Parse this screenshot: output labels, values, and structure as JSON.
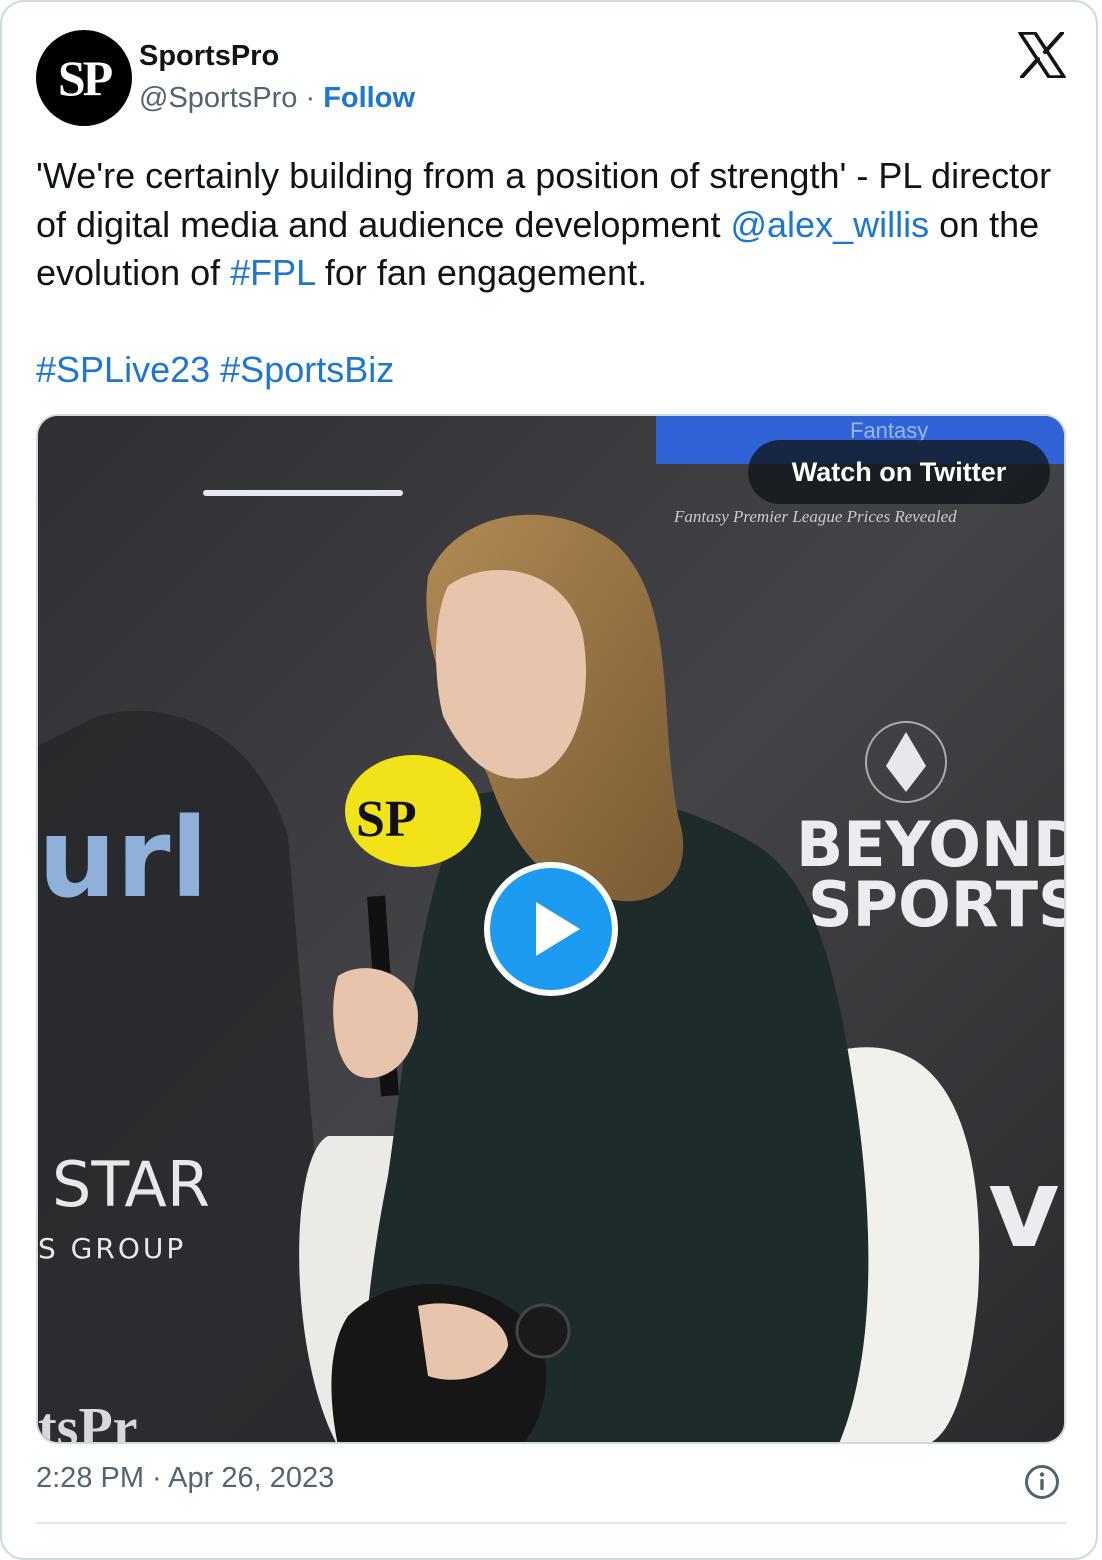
{
  "author": {
    "avatar_text": "SP",
    "name": "SportsPro",
    "handle": "@SportsPro",
    "separator": "·",
    "follow_label": "Follow"
  },
  "tweet": {
    "text_part1": "'We're certainly building from a position of strength' - PL director of digital media and audience development ",
    "mention": "@alex_willis",
    "text_part2": " on the evolution of ",
    "hashtag_fpl": "#FPL",
    "text_part3": " for fan engagement.",
    "hashtag_splive": "#SPLive23",
    "hashtag_sportsbiz": "#SportsBiz"
  },
  "media": {
    "watch_label": "Watch on Twitter",
    "backdrop_text_fantasy": "Fantasy",
    "backdrop_caption": "Fantasy Premier League Prices Revealed",
    "backdrop_text_url": "url",
    "backdrop_text_beyond": "BEYOND",
    "backdrop_text_sports": "SPORTS",
    "backdrop_text_star": "STAR",
    "backdrop_text_group": "S GROUP",
    "backdrop_text_sportspro": "tsPr",
    "backdrop_text_vu": "vu",
    "mic_label": "SP"
  },
  "footer": {
    "timestamp": "2:28 PM · Apr 26, 2023"
  },
  "colors": {
    "link": "#1d76d2",
    "play_button": "#1d9bf0",
    "border": "#cfd9de"
  }
}
